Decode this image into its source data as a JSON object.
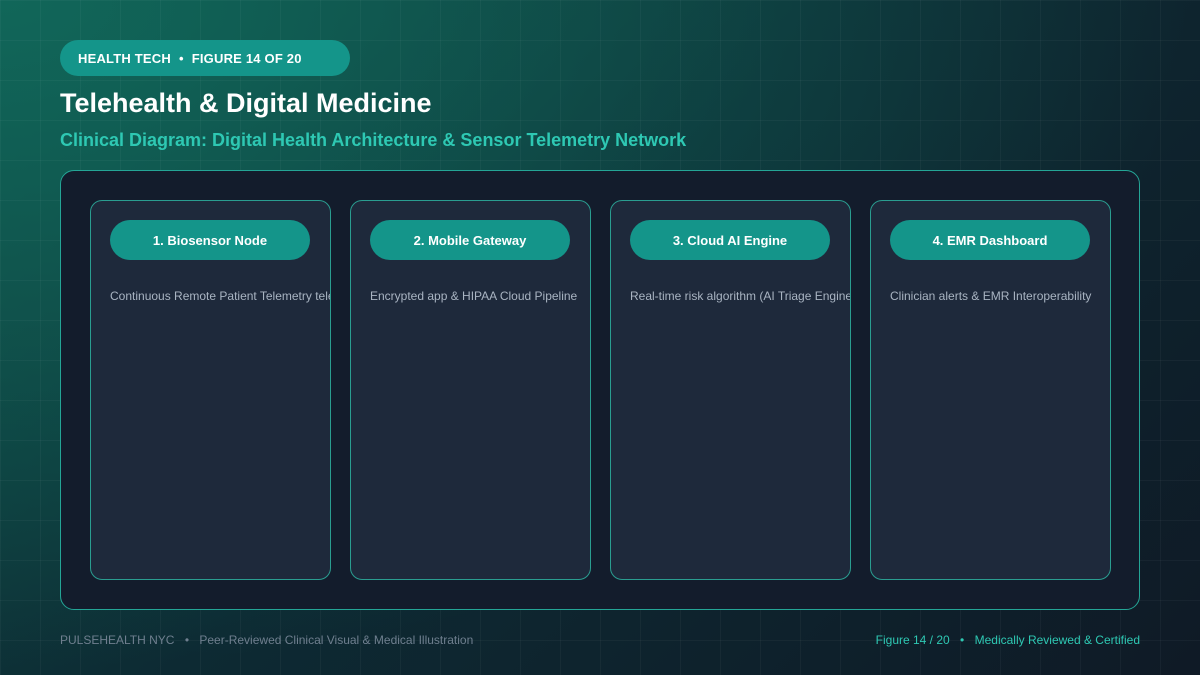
{
  "header": {
    "category": "HEALTH TECH",
    "separator": "•",
    "figure_label": "FIGURE 14 OF 20",
    "title": "Telehealth & Digital Medicine",
    "subtitle": "Clinical Diagram: Digital Health Architecture & Sensor Telemetry Network"
  },
  "diagram": {
    "nodes": [
      {
        "label": "1. Biosensor Node",
        "description": "Continuous Remote Patient Telemetry telemetry"
      },
      {
        "label": "2. Mobile Gateway",
        "description": "Encrypted app & HIPAA Cloud Pipeline"
      },
      {
        "label": "3. Cloud AI Engine",
        "description": "Real-time risk algorithm (AI Triage Engine)"
      },
      {
        "label": "4. EMR Dashboard",
        "description": "Clinician alerts & EMR Interoperability"
      }
    ]
  },
  "footer": {
    "org": "PULSEHEALTH NYC",
    "separator": "•",
    "caption": "Peer-Reviewed Clinical Visual & Medical Illustration",
    "figure": "Figure 14 / 20",
    "certification": "Medically Reviewed & Certified"
  },
  "colors": {
    "accent": "#14958a",
    "accent_text": "#2ec8b3",
    "panel_bg": "#131c2c",
    "card_bg": "#1e293b"
  }
}
